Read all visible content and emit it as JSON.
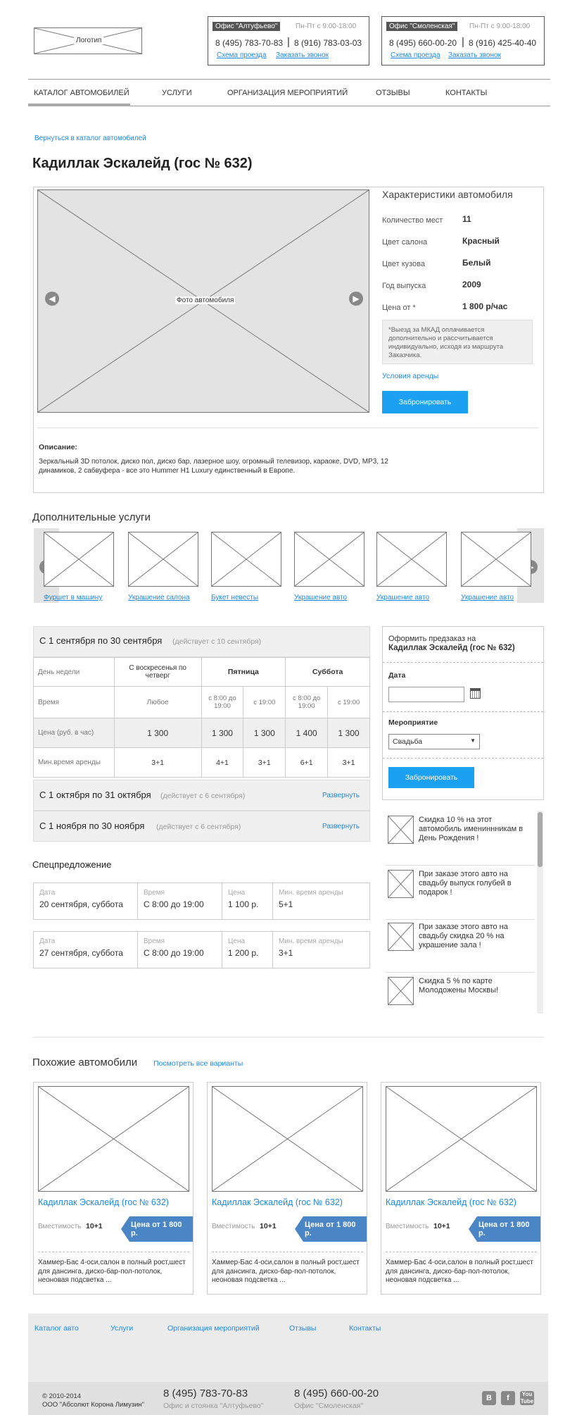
{
  "header": {
    "logo": "Логотип",
    "offices": [
      {
        "name": "Офис \"Алтуфьево\"",
        "hours": "Пн-Пт с 9:00-18:00",
        "phone1": "8 (495) 783-70-83",
        "phone2": "8 (916) 783-03-03",
        "map": "Схема проезда",
        "call": "Заказать звонок"
      },
      {
        "name": "Офис \"Смоленская\"",
        "hours": "Пн-Пт с 9:00-18:00",
        "phone1": "8 (495) 660-00-20",
        "phone2": "8 (916) 425-40-40",
        "map": "Схема проезда",
        "call": "Заказать звонок"
      }
    ]
  },
  "nav": [
    "Каталог автомобилей",
    "Услуги",
    "Организация мероприятий",
    "Отзывы",
    "Контакты"
  ],
  "back_link": "Вернуться в каталог автомобилей",
  "title": "Кадиллак Эскалейд (гос № 632)",
  "photo_label": "Фото автомобиля",
  "specs": {
    "heading": "Характеристики автомобиля",
    "rows": [
      {
        "label": "Количество мест",
        "value": "11"
      },
      {
        "label": "Цвет салона",
        "value": "Красный"
      },
      {
        "label": "Цвет кузова",
        "value": "Белый"
      },
      {
        "label": "Год выпуска",
        "value": "2009"
      },
      {
        "label": "Цена от *",
        "value": "1 800 р/час"
      }
    ],
    "note": "*Выезд за МКАД оплачивается дополнительно и рассчитывается индивидуально, исходя из маршрута Заказчика.",
    "rent_terms": "Условия аренды",
    "book": "Забронировать"
  },
  "description": {
    "heading": "Описание:",
    "text": "Зеркальный 3D потолок, диско пол, диско бар, лазерное шоу, огромный телевизор, караоке, DVD, MP3, 12 динамиков, 2 сабвуфера - все это Hummer H1 Luxury единственный в Европе."
  },
  "extras": {
    "heading": "Дополнительные услуги",
    "items": [
      "Фуршет в машину",
      "Украшение салона",
      "Букет невесты",
      "Украшение авто",
      "Украшение авто",
      "Украшение авто"
    ]
  },
  "pricing": {
    "period1": {
      "title": "С 1 сентября по 30 сентября",
      "note": "(действует с 10 сентября)"
    },
    "headers": [
      "День недели",
      "С воскресенья по четверг",
      "Пятница",
      "Суббота"
    ],
    "time_row": {
      "label": "Время",
      "any": "Любое",
      "t1": "с 8:00 до 19:00",
      "t2": "с 19:00",
      "t3": "с 8:00 до 19:00",
      "t4": "с 19:00"
    },
    "price_row": {
      "label": "Цена (руб. в час)",
      "values": [
        "1 300",
        "1 300",
        "1 300",
        "1 400",
        "1 300"
      ]
    },
    "min_row": {
      "label": "Мин.время аренды",
      "values": [
        "3+1",
        "4+1",
        "3+1",
        "6+1",
        "3+1"
      ]
    },
    "period2": {
      "title": "С 1 октября по 31 октября",
      "note": "(действует с 6 сентября)",
      "expand": "Развернуть"
    },
    "period3": {
      "title": "С 1 ноября по 30 ноября",
      "note": "(действует с 6 сентября)",
      "expand": "Развернуть"
    }
  },
  "preorder": {
    "heading": "Оформить предзаказ на",
    "car": "Кадиллак Эскалейд (гос № 632)",
    "date_label": "Дата",
    "event_label": "Мероприятие",
    "event_value": "Свадьба",
    "book": "Забронировать"
  },
  "promos": [
    "Скидка 10 % на этот автомобиль имениннникам в День Рождения !",
    "При заказе этого авто на свадьбу выпуск голубей в подарок !",
    "При заказе этого авто на свадьбу скидка 20 % на украшение зала !",
    "Скидка 5 % по карте Молодожены Москвы!"
  ],
  "special": {
    "heading": "Спецпредложение",
    "captions": [
      "Дата",
      "Время",
      "Цена",
      "Мин. время аренды"
    ],
    "offers": [
      {
        "date": "20 сентября, суббота",
        "time": "С 8:00 до 19:00",
        "price": "1 100 р.",
        "min": "5+1"
      },
      {
        "date": "27 сентября, суббота",
        "time": "С 8:00 до 19:00",
        "price": "1 200 р.",
        "min": "3+1"
      }
    ]
  },
  "similar": {
    "heading": "Похожие автомобили",
    "all_link": "Посмотреть все варианты",
    "cards": [
      {
        "title": "Кадиллак Эскалейд (гос № 632)",
        "cap_label": "Вместимость",
        "cap": "10+1",
        "price": "Цена от 1 800 р.",
        "desc": "Хаммер-Бас 4-оси,салон в полный рост,шест для дансинга, диско-бар-пол-потолок, неоновая подсветка ..."
      },
      {
        "title": "Кадиллак Эскалейд (гос № 632)",
        "cap_label": "Вместимость",
        "cap": "10+1",
        "price": "Цена от 1 800 р.",
        "desc": "Хаммер-Бас 4-оси,салон в полный рост,шест для дансинга, диско-бар-пол-потолок, неоновая подсветка ..."
      },
      {
        "title": "Кадиллак Эскалейд (гос № 632)",
        "cap_label": "Вместимость",
        "cap": "10+1",
        "price": "Цена от 1 800 р.",
        "desc": "Хаммер-Бас 4-оси,салон в полный рост,шест для дансинга, диско-бар-пол-потолок, неоновая подсветка ..."
      }
    ]
  },
  "footer": {
    "links": [
      "Каталог авто",
      "Услуги",
      "Организация мероприятий",
      "Отзывы",
      "Контакты"
    ],
    "copy1": "© 2010-2014",
    "copy2": "ООО \"Абсолют Корона Лимузин\"",
    "phone1": "8 (495) 783-70-83",
    "place1": "Офис и стоянка \"Алтуфьево\"",
    "phone2": "8 (495) 660-00-20",
    "place2": "Офис \"Смоленская\"",
    "social": [
      "vk-icon",
      "facebook-icon",
      "youtube-icon"
    ]
  },
  "colors": {
    "accent": "#1ba0f2",
    "price_tag": "#4a85c6"
  }
}
